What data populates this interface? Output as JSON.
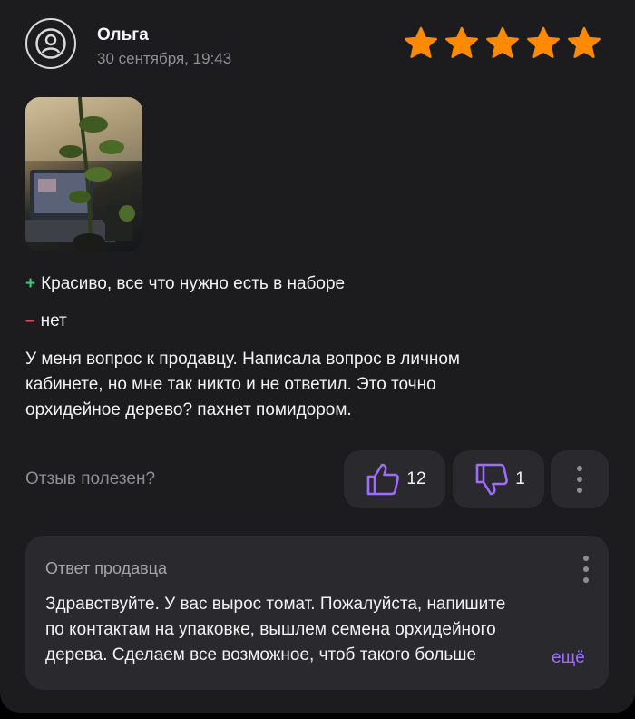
{
  "review": {
    "author": "Ольга",
    "date": "30 сентября, 19:43",
    "rating": 5,
    "pros": "Красиво, все что нужно есть в наборе",
    "cons": "нет",
    "text_lines": [
      "У меня вопрос к продавцу. Написала вопрос в личном",
      "кабинете, но мне так никто и не ответил. Это точно",
      "орхидейное дерево? пахнет помидором."
    ],
    "useful_label": "Отзыв полезен?",
    "likes": "12",
    "dislikes": "1"
  },
  "seller_reply": {
    "title": "Ответ продавца",
    "lines": [
      "Здравствуйте. У вас вырос томат. Пожалуйста, напишите",
      "по контактам на упаковке, вышлем семена орхидейного",
      "дерева. Сделаем все возможное, чтоб такого больше"
    ],
    "expand_label": "ещё"
  },
  "colors": {
    "star": "#ff8a00",
    "plus": "#2fcf75",
    "minus": "#ff3b5c",
    "accent": "#a06bff"
  },
  "icons": [
    "user-icon",
    "star-icon",
    "thumbs-up-icon",
    "thumbs-down-icon",
    "more-vertical-icon"
  ]
}
